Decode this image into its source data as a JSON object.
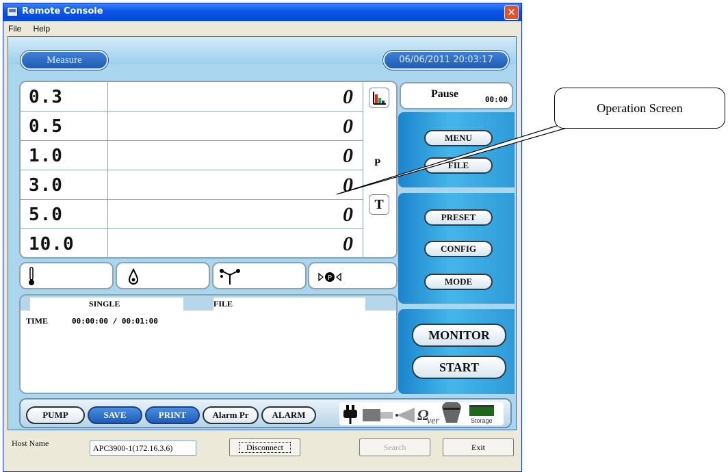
{
  "window": {
    "title": "Remote Console",
    "close_glyph": "✕"
  },
  "menu": {
    "items": [
      "File",
      "Help"
    ]
  },
  "header": {
    "tab_label": "Measure",
    "datetime": "06/06/2011 20:03:17"
  },
  "measurements": {
    "rows": [
      {
        "size": "0.3",
        "count": "0"
      },
      {
        "size": "0.5",
        "count": "0"
      },
      {
        "size": "1.0",
        "count": "0"
      },
      {
        "size": "3.0",
        "count": "0"
      },
      {
        "size": "5.0",
        "count": "0"
      },
      {
        "size": "10.0",
        "count": "0"
      }
    ],
    "unit": "P",
    "t_button": "T"
  },
  "env_icons": [
    "thermometer-icon",
    "humidity-drop-icon",
    "air-flow-icon",
    "pressure-icon"
  ],
  "info": {
    "mode": "SINGLE",
    "target": "FILE",
    "time_label": "TIME",
    "time_value": "00:00:00 / 00:01:00"
  },
  "status": {
    "state": "Pause",
    "time": "00:00"
  },
  "controls": {
    "menu": "MENU",
    "file": "FILE",
    "preset": "PRESET",
    "config": "CONFIG",
    "mode": "MODE",
    "monitor": "MONITOR",
    "start": "START"
  },
  "bottom_buttons": [
    "PUMP",
    "SAVE",
    "PRINT",
    "Alarm Pr",
    "ALARM"
  ],
  "status_icons": [
    "power-plug-icon",
    "probe-icon",
    "sensor-cone-icon",
    "omega-ver-icon",
    "filter-icon",
    "storage-icon"
  ],
  "status_text": {
    "storage": "Storage",
    "ver": "ver"
  },
  "footer": {
    "host_label": "Host Name",
    "host_value": "APC3900-1(172.16.3.6)",
    "disconnect": "Disconnect",
    "search": "Search",
    "exit": "Exit"
  },
  "annotation": {
    "callout": "Operation Screen"
  },
  "colors": {
    "titlebar": "#0a56e6",
    "panel_blue": "#2f9ad8",
    "app_bg": "#aad6ee"
  }
}
